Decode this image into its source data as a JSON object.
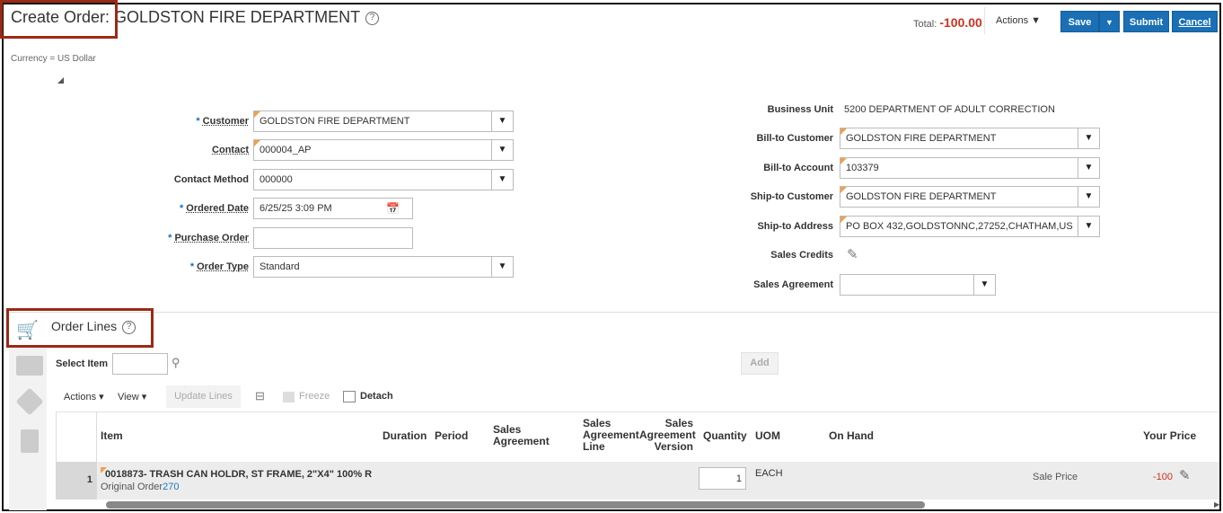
{
  "header": {
    "title": "Create Order: GOLDSTON FIRE DEPARTMENT",
    "help": "?",
    "total_label": "Total:",
    "total_value": "-100.00",
    "actions": "Actions",
    "save": "Save",
    "submit": "Submit",
    "cancel": "Cancel",
    "currency": "Currency = US Dollar"
  },
  "left_form": [
    {
      "label": "Customer",
      "value": "GOLDSTON FIRE DEPARTMENT",
      "required": true
    },
    {
      "label": "Contact",
      "value": "000004_AP"
    },
    {
      "label": "Contact Method",
      "value": "000000"
    },
    {
      "label": "Ordered Date",
      "value": "6/25/25 3:09 PM",
      "required": true
    },
    {
      "label": "Purchase Order",
      "value": "",
      "required": true
    },
    {
      "label": "Order Type",
      "value": "Standard",
      "required": true
    }
  ],
  "right_form": {
    "business_unit_label": "Business Unit",
    "business_unit_value": "5200 DEPARTMENT OF ADULT CORRECTION",
    "bill_to_customer_label": "Bill-to Customer",
    "bill_to_customer": "GOLDSTON FIRE DEPARTMENT",
    "bill_to_account_label": "Bill-to Account",
    "bill_to_account": "103379",
    "ship_to_customer_label": "Ship-to Customer",
    "ship_to_customer": "GOLDSTON FIRE DEPARTMENT",
    "ship_to_address_label": "Ship-to Address",
    "ship_to_address": "PO BOX 432,GOLDSTONNC,27252,CHATHAM,US",
    "sales_credits_label": "Sales Credits",
    "sales_agreement_label": "Sales Agreement",
    "sales_agreement": ""
  },
  "order_lines": {
    "title": "Order Lines",
    "select_item": "Select Item",
    "add": "Add",
    "toolbar": {
      "actions": "Actions",
      "view": "View",
      "update_lines": "Update Lines",
      "freeze": "Freeze",
      "detach": "Detach"
    },
    "columns": {
      "item": "Item",
      "duration": "Duration",
      "period": "Period",
      "sales_agreement": "Sales Agreement",
      "sa_line": "Sales Agreement Line",
      "sa_version": "Sales Agreement Version",
      "quantity": "Quantity",
      "uom": "UOM",
      "on_hand": "On Hand",
      "your_price": "Your Price"
    },
    "row": {
      "num": "1",
      "item": "0018873- TRASH CAN HOLDR, ST FRAME, 2\"X4\" 100% R",
      "original_order_label": "Original Order",
      "original_order": "270",
      "quantity": "1",
      "uom": "EACH",
      "price_type": "Sale Price",
      "price": "-100"
    }
  }
}
